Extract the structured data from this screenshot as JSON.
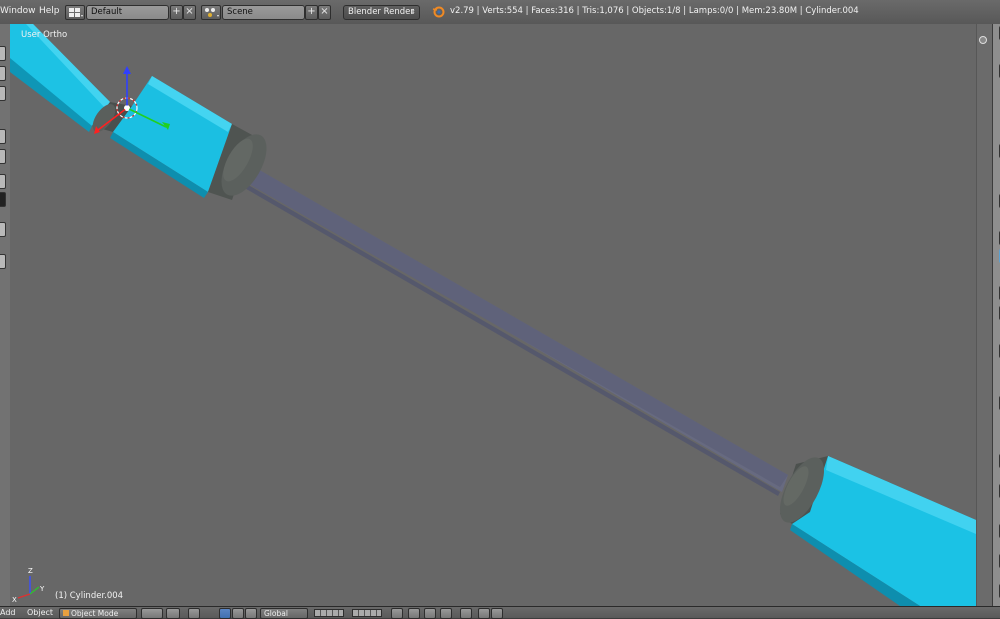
{
  "header": {
    "menus": [
      "Window",
      "Help"
    ],
    "screen_layout": "Default",
    "scene": "Scene",
    "render_engine": "Blender Render",
    "stats": "v2.79 | Verts:554 | Faces:316 | Tris:1,076 | Objects:1/8 | Lamps:0/0 | Mem:23.80M | Cylinder.004"
  },
  "viewport": {
    "view_name": "User Ortho",
    "active_object": "(1) Cylinder.004",
    "axis_labels": {
      "x": "X",
      "y": "Y",
      "z": "Z"
    }
  },
  "footer": {
    "add_label": "Add",
    "object_menu": "Object",
    "mode": "Object Mode",
    "orientation": "Global"
  },
  "icons": {
    "layout": "screen-layout-icon",
    "scene": "scene-icon",
    "engine_logo": "blender-logo-icon",
    "add": "plus-icon",
    "remove": "x-icon"
  },
  "colors": {
    "viewport_bg": "#676767",
    "tube_cyan": "#17c3e6",
    "rod_blue_gray": "#676a80",
    "cap_gray": "#5a5f5c",
    "header_bg": "#5f5f5f"
  }
}
